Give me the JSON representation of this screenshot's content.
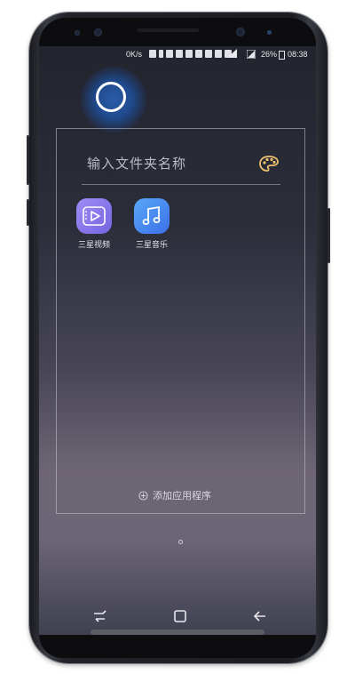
{
  "status_bar": {
    "network_speed": "0K/s",
    "battery_percent": "26%",
    "time": "08:38"
  },
  "folder": {
    "name_placeholder": "输入文件夹名称",
    "apps": [
      {
        "label": "三星视频",
        "icon": "video-play-icon",
        "color": "#8b7ff0"
      },
      {
        "label": "三星音乐",
        "icon": "music-note-icon",
        "color": "#4a8ef0"
      }
    ],
    "add_apps_label": "添加应用程序"
  },
  "page_indicator": {
    "current": 1,
    "total": 1
  },
  "nav_bar": {
    "recents_icon": "recents-icon",
    "home_icon": "home-icon",
    "back_icon": "back-arrow-icon"
  }
}
